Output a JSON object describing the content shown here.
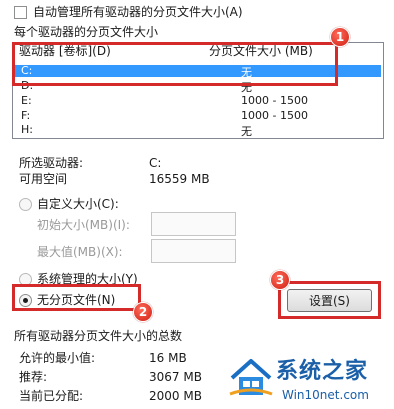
{
  "auto_manage_label": "自动管理所有驱动器的分页文件大小(A)",
  "per_drive_group_label": "每个驱动器的分页文件大小",
  "drive_list": {
    "header_drive": "驱动器 [卷标](D)",
    "header_size": "分页文件大小 (MB)",
    "rows": [
      {
        "drive": "C:",
        "size": "无"
      },
      {
        "drive": "D:",
        "size": "无"
      },
      {
        "drive": "E:",
        "size": "1000 - 1500"
      },
      {
        "drive": "F:",
        "size": "1000 - 1500"
      },
      {
        "drive": "H:",
        "size": "无"
      }
    ]
  },
  "selected_drive_label": "所选驱动器:",
  "selected_drive_value": "C:",
  "free_space_label": "可用空间",
  "free_space_value": "16559 MB",
  "custom_size_label": "自定义大小(C):",
  "initial_size_label": "初始大小(MB)(I):",
  "max_size_label": "最大值(MB)(X):",
  "system_managed_label": "系统管理的大小(Y)",
  "no_paging_label": "无分页文件(N)",
  "set_button_label": "设置(S)",
  "totals_group_label": "所有驱动器分页文件大小的总数",
  "min_allowed_label": "允许的最小值:",
  "min_allowed_value": "16 MB",
  "recommended_label": "推荐:",
  "recommended_value": "3067 MB",
  "allocated_label": "当前已分配:",
  "allocated_value": "2000 MB",
  "badges": [
    "1",
    "2",
    "3"
  ],
  "watermark": {
    "brand": "系统之家",
    "url": "Win10net.com"
  },
  "colors": {
    "highlight": "#d42a2a",
    "selection": "#3399ff",
    "watermark": "#1a5fa8"
  }
}
